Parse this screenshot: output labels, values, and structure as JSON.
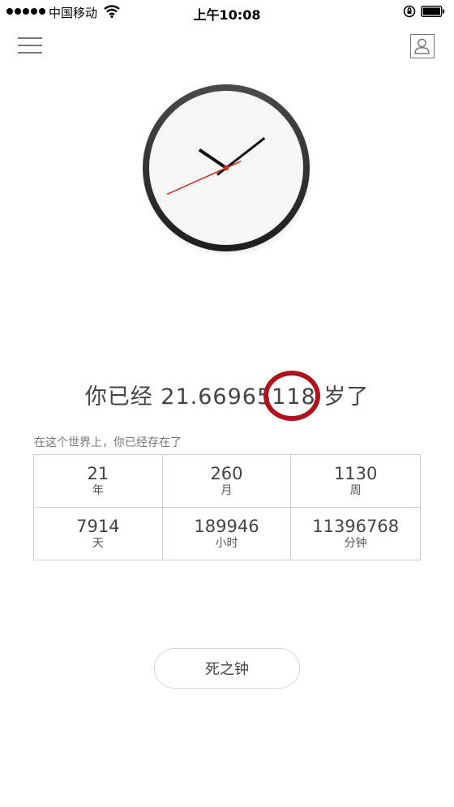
{
  "status_bar": {
    "carrier": "中国移动",
    "time": "上午10:08",
    "icons": [
      "signal-dots",
      "wifi-icon",
      "rotation-lock-icon",
      "battery-icon"
    ]
  },
  "nav": {
    "menu_icon": "hamburger-menu-icon",
    "profile_icon": "user-profile-icon"
  },
  "clock": {
    "hour": 10,
    "minute": 8,
    "second": 41,
    "colors": {
      "rim": "#2d2d2d",
      "face": "#f7f6f6",
      "hands": "#111111",
      "second_hand": "#d62a1e"
    }
  },
  "age": {
    "prefix": "你已经",
    "value_main": "21.66965",
    "value_marked": "118",
    "suffix": "岁了",
    "marker_color": "#b0121b"
  },
  "exist_caption": "在这个世界上，你已经存在了",
  "stats": [
    {
      "value": "21",
      "unit": "年"
    },
    {
      "value": "260",
      "unit": "月"
    },
    {
      "value": "1130",
      "unit": "周"
    },
    {
      "value": "7914",
      "unit": "天"
    },
    {
      "value": "189946",
      "unit": "小时"
    },
    {
      "value": "11396768",
      "unit": "分钟"
    }
  ],
  "button": {
    "label": "死之钟"
  }
}
